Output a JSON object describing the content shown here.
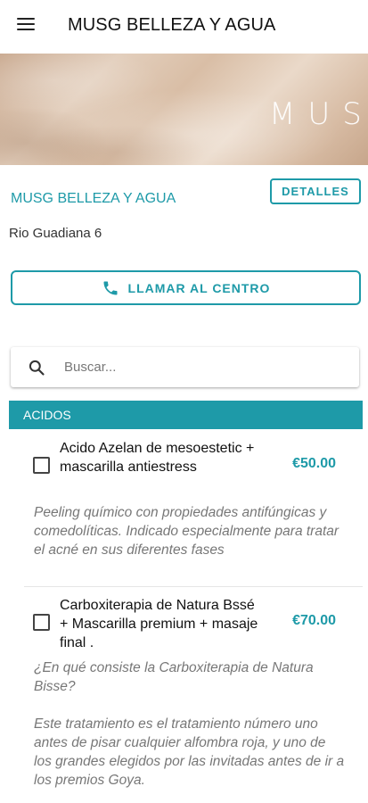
{
  "appbar": {
    "title": "MUSG BELLEZA Y AGUA",
    "menu_icon": "hamburger-menu-icon"
  },
  "banner": {
    "logo_text": "MUS"
  },
  "center": {
    "name": "MUSG BELLEZA Y AGUA",
    "details_label": "DETALLES",
    "address": "Rio Guadiana 6",
    "call_label": "LLAMAR AL CENTRO",
    "call_icon": "phone-icon"
  },
  "search": {
    "placeholder": "Buscar...",
    "value": "",
    "icon": "search-icon"
  },
  "colors": {
    "accent": "#1e9aa8"
  },
  "category": {
    "label": "ACIDOS",
    "services": [
      {
        "name": "Acido Azelan de mesoestetic + mascarilla antiestress",
        "price": "€50.00",
        "checked": false,
        "description": "Peeling químico con propiedades antifúngicas y comedolíticas. Indicado especialmente para tratar el acné en sus diferentes fases"
      },
      {
        "name": "Carboxiterapia de Natura Bssé + Mascarilla premium + masaje final .",
        "price": "€70.00",
        "checked": false,
        "description": "¿En qué consiste la Carboxiterapia de Natura Bisse?",
        "description_2": "Este tratamiento es el tratamiento número uno antes de pisar cualquier alfombra roja, y uno de los grandes elegidos por las invitadas antes de ir a los premios Goya."
      }
    ]
  }
}
